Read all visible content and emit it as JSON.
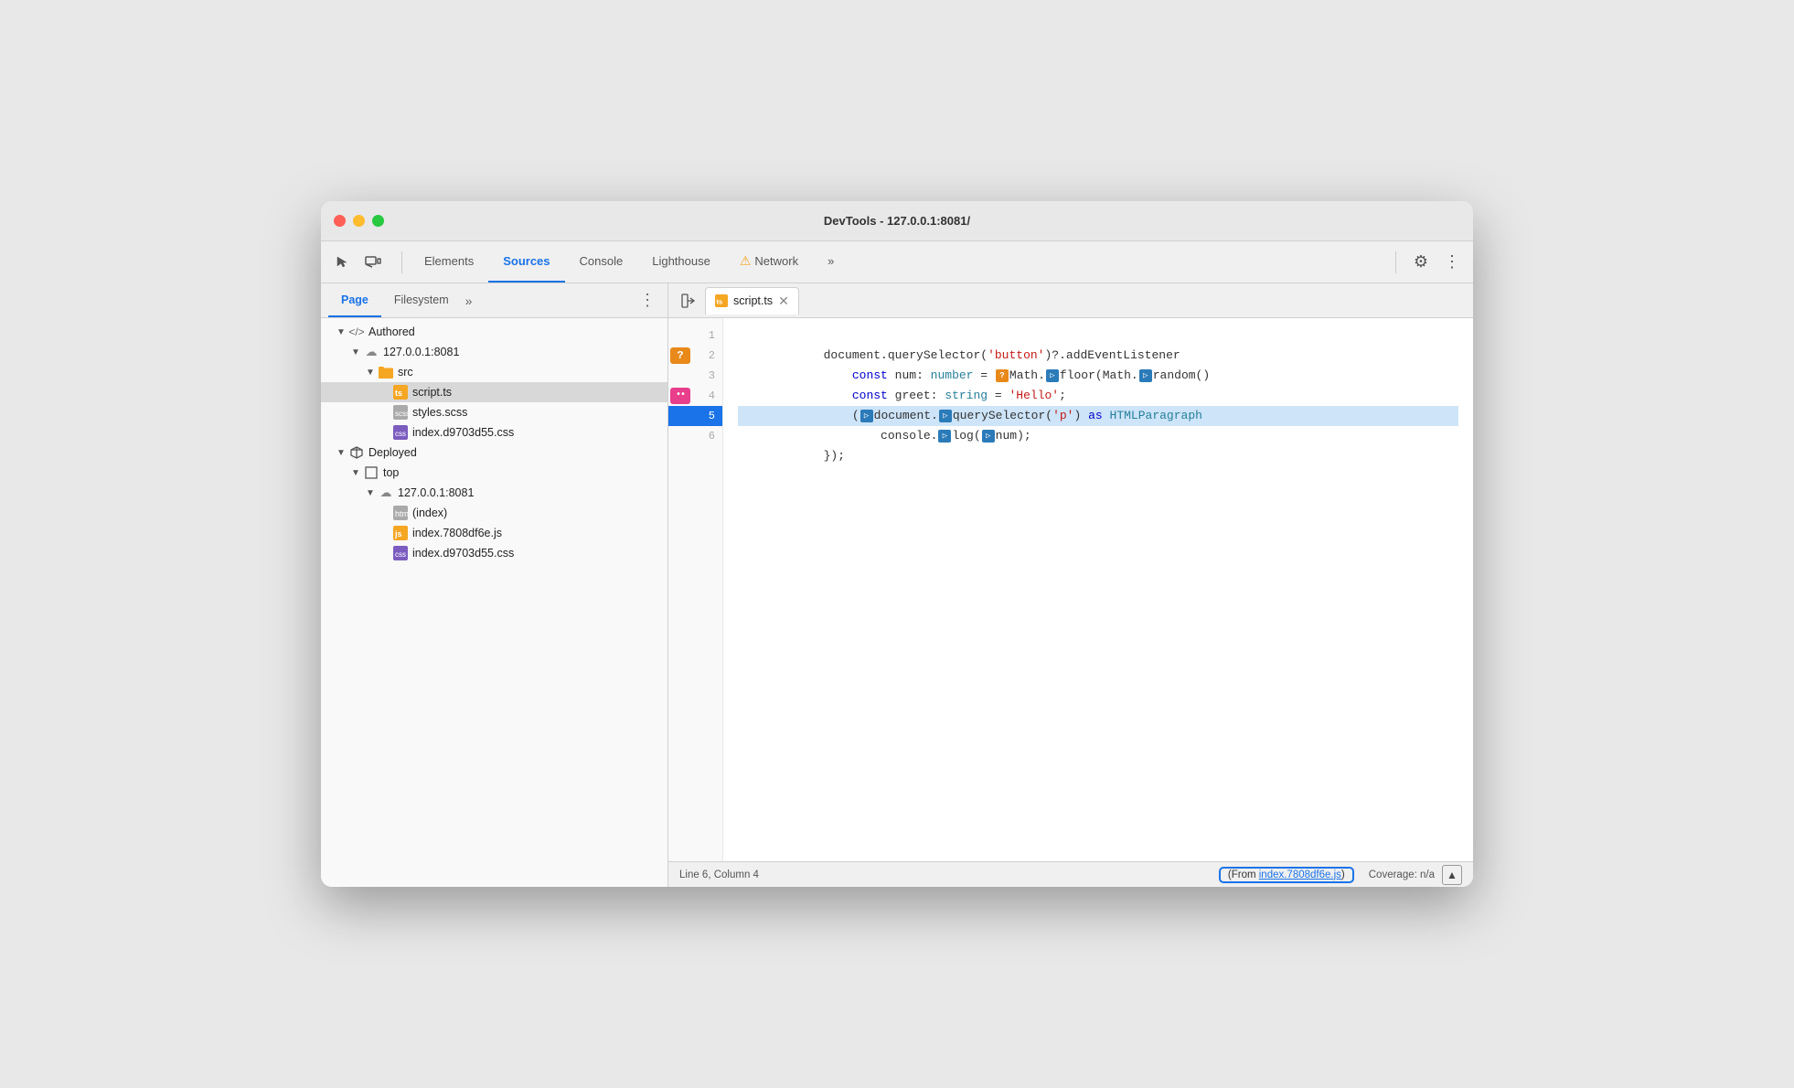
{
  "window": {
    "title": "DevTools - 127.0.0.1:8081/"
  },
  "toolbar": {
    "tabs": [
      {
        "label": "Elements",
        "active": false
      },
      {
        "label": "Sources",
        "active": true
      },
      {
        "label": "Console",
        "active": false
      },
      {
        "label": "Lighthouse",
        "active": false
      },
      {
        "label": "Network",
        "active": false,
        "warning": true
      }
    ],
    "more_label": "»",
    "settings_icon": "⚙",
    "dots_icon": "⋮"
  },
  "sidebar": {
    "tabs": [
      {
        "label": "Page",
        "active": true
      },
      {
        "label": "Filesystem",
        "active": false
      }
    ],
    "more_label": "»",
    "menu_icon": "⋮",
    "tree": [
      {
        "level": 1,
        "type": "section",
        "icon": "code",
        "label": "Authored",
        "expanded": true
      },
      {
        "level": 2,
        "type": "cloud",
        "label": "127.0.0.1:8081",
        "expanded": true
      },
      {
        "level": 3,
        "type": "folder",
        "label": "src",
        "expanded": true
      },
      {
        "level": 4,
        "type": "ts",
        "label": "script.ts",
        "selected": true
      },
      {
        "level": 4,
        "type": "scss",
        "label": "styles.scss"
      },
      {
        "level": 4,
        "type": "css",
        "label": "index.d9703d55.css"
      },
      {
        "level": 1,
        "type": "section",
        "icon": "box",
        "label": "Deployed",
        "expanded": true
      },
      {
        "level": 2,
        "type": "box-child",
        "label": "top",
        "expanded": true
      },
      {
        "level": 3,
        "type": "cloud",
        "label": "127.0.0.1:8081",
        "expanded": true
      },
      {
        "level": 4,
        "type": "html",
        "label": "(index)"
      },
      {
        "level": 4,
        "type": "js",
        "label": "index.7808df6e.js"
      },
      {
        "level": 4,
        "type": "css",
        "label": "index.d9703d55.css"
      }
    ]
  },
  "editor": {
    "back_icon": "◀",
    "file_tab": "script.ts",
    "close_icon": "✕",
    "lines": [
      {
        "num": 1,
        "badge": null,
        "code": "document.querySelector('button')?.addEventListener"
      },
      {
        "num": 2,
        "badge": "?",
        "badge_color": "orange",
        "code": "    const num: number = Math.floor(Math.random()"
      },
      {
        "num": 3,
        "badge": null,
        "code": "    const greet: string = 'Hello';"
      },
      {
        "num": 4,
        "badge": "..",
        "badge_color": "pink",
        "code": "    (document.querySelector('p') as HTMLParagraph"
      },
      {
        "num": 5,
        "badge": null,
        "badge_color": "blue",
        "selected": true,
        "code": "        console.log(num);"
      },
      {
        "num": 6,
        "badge": null,
        "code": "});"
      }
    ]
  },
  "status_bar": {
    "position": "Line 6, Column 4",
    "source_label": "From ",
    "source_link": "index.7808df6e.js",
    "source_suffix": ")",
    "source_prefix": "(",
    "coverage": "Coverage: n/a"
  }
}
